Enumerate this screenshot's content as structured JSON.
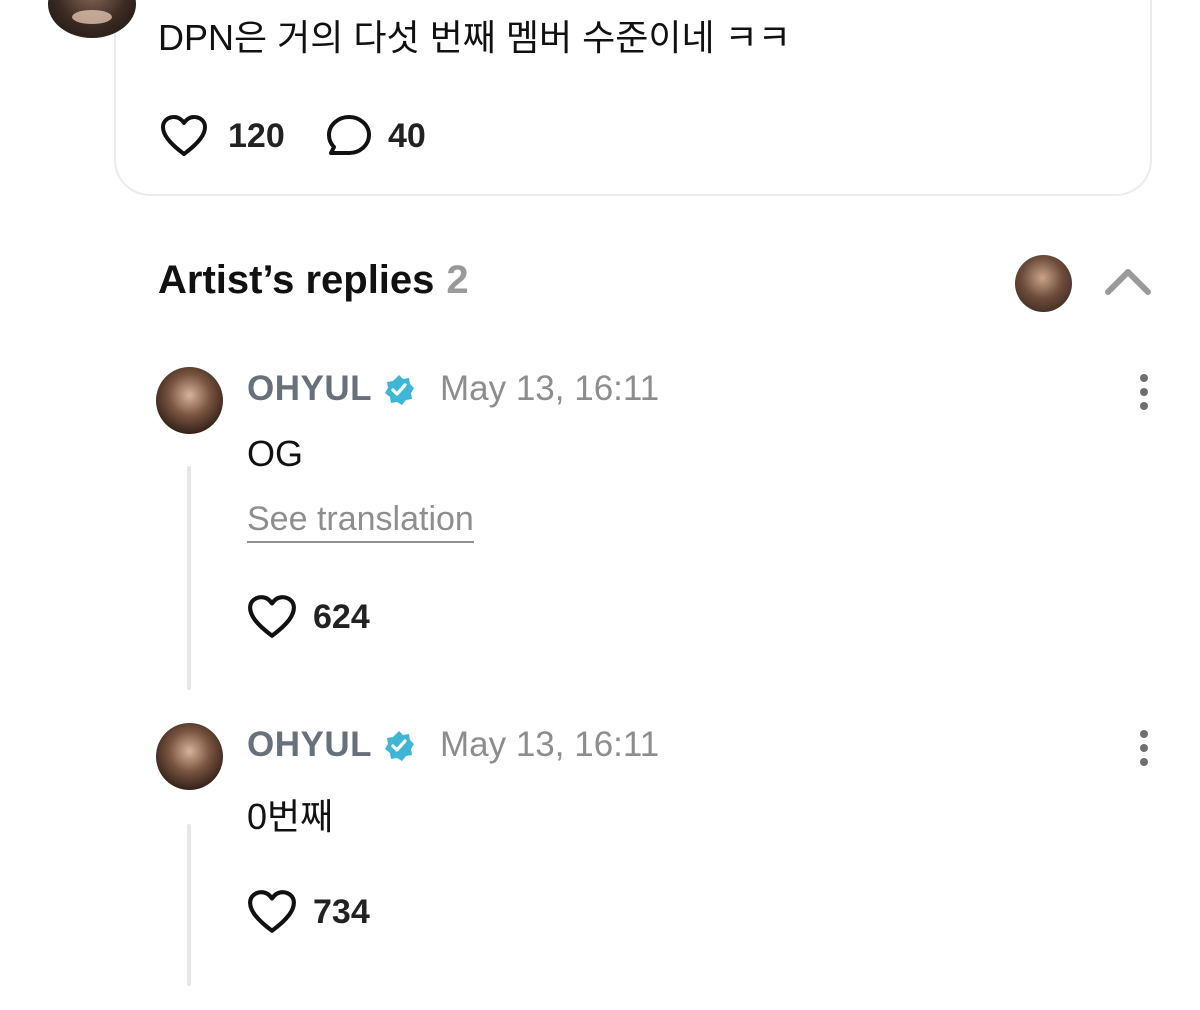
{
  "post": {
    "text": "DPN은 거의 다섯 번째 멤버 수준이네 ㅋㅋ",
    "likes": "120",
    "comments": "40"
  },
  "artist_replies": {
    "title": "Artist’s replies",
    "count": "2"
  },
  "replies": [
    {
      "name": "OHYUL",
      "time": "May 13, 16:11",
      "text": "OG",
      "see_translation": "See translation",
      "likes": "624"
    },
    {
      "name": "OHYUL",
      "time": "May 13, 16:11",
      "text": "0번째",
      "likes": "734"
    }
  ],
  "colors": {
    "verified": "#3fb6d6",
    "name": "#68707c",
    "muted": "#8d8d8d"
  },
  "icons": [
    "heart-icon",
    "comment-icon",
    "verified-badge-icon",
    "chevron-up-icon",
    "more-vertical-icon"
  ]
}
